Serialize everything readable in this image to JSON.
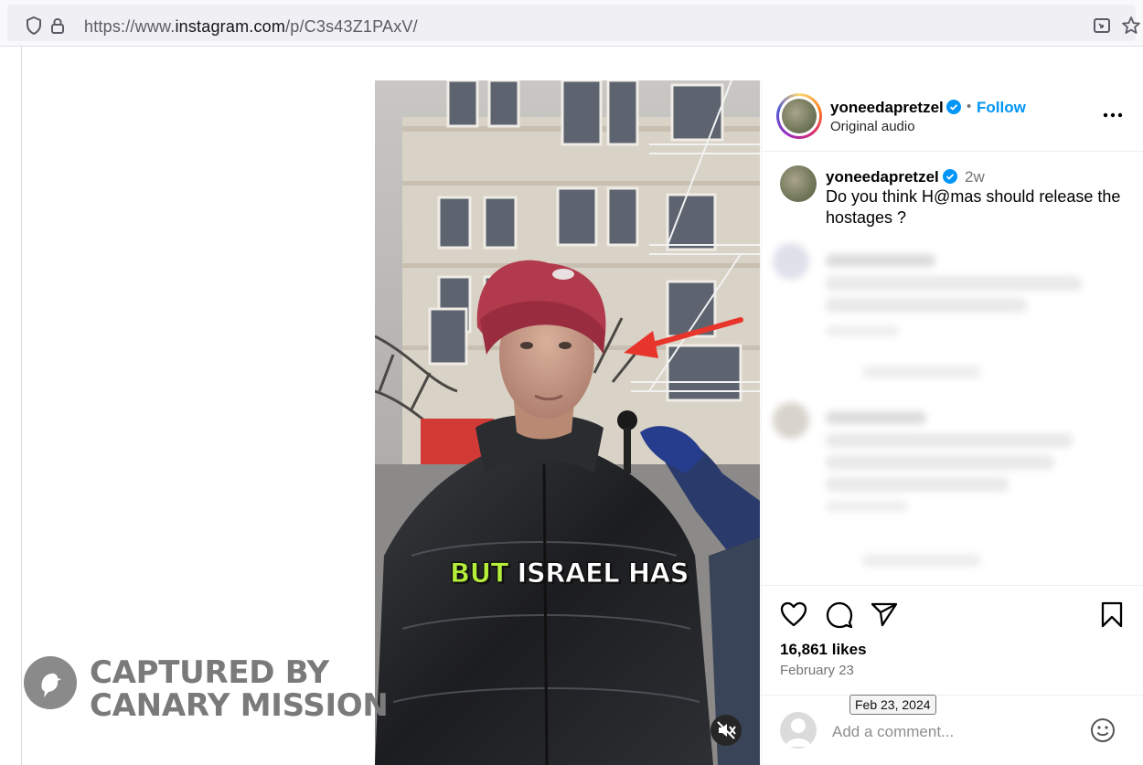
{
  "browser": {
    "url_prefix": "https://www.",
    "url_domain": "instagram.com",
    "url_path": "/p/C3s43Z1PAxV/"
  },
  "post": {
    "overlay_word_highlight": "BUT",
    "overlay_word_rest": "ISRAEL HAS",
    "header": {
      "username": "yoneedapretzel",
      "separator": "•",
      "follow_label": "Follow",
      "audio_label": "Original audio"
    },
    "caption": {
      "username": "yoneedapretzel",
      "age": "2w",
      "text": "Do you think H@mas should release the hostages ?"
    },
    "likes": "16,861 likes",
    "date": "February 23",
    "date_tooltip": "Feb 23, 2024",
    "comment_placeholder": "Add a comment..."
  },
  "watermark": {
    "line1": "CAPTURED BY",
    "line2": "CANARY MISSION"
  },
  "colors": {
    "follow_blue": "#0095f6",
    "verified_blue": "#0095f6",
    "overlay_highlight": "#b4ee3b",
    "arrow_red": "#e8352c"
  },
  "icons": [
    "shield-icon",
    "lock-icon",
    "picture-in-picture-icon",
    "star-icon",
    "verified-badge-icon",
    "more-options-icon",
    "heart-icon",
    "comment-icon",
    "share-icon",
    "bookmark-icon",
    "mute-icon",
    "emoji-icon",
    "canary-bird-icon"
  ]
}
